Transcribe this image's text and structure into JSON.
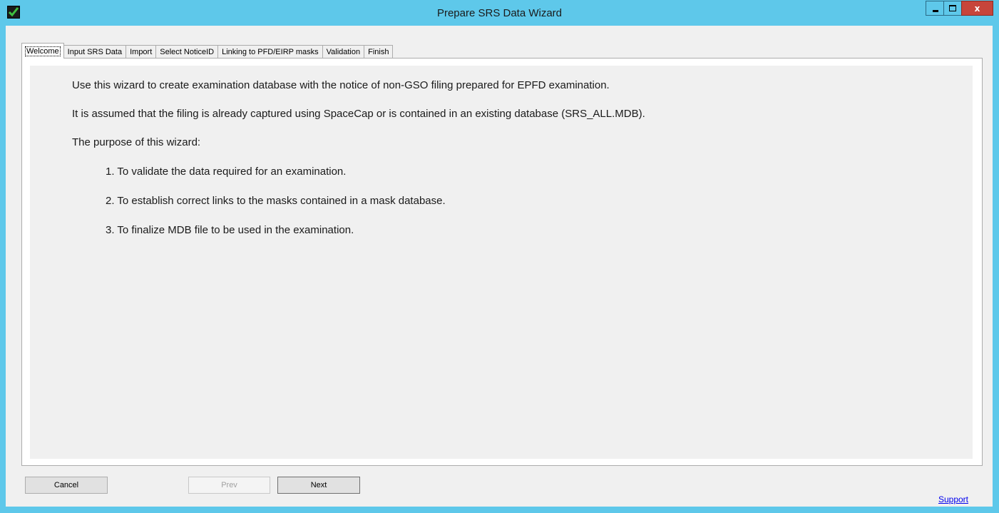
{
  "window": {
    "title": "Prepare SRS Data Wizard",
    "icon": "green-checkmark-icon",
    "controls": {
      "minimize": "minimize-icon",
      "maximize": "maximize-icon",
      "close_label": "x"
    }
  },
  "tabs": [
    {
      "label": "Welcome",
      "active": true
    },
    {
      "label": "Input SRS Data",
      "active": false
    },
    {
      "label": "Import",
      "active": false
    },
    {
      "label": "Select NoticeID",
      "active": false
    },
    {
      "label": "Linking to PFD/EIRP masks",
      "active": false
    },
    {
      "label": "Validation",
      "active": false
    },
    {
      "label": "Finish",
      "active": false
    }
  ],
  "welcome": {
    "line1": "Use this wizard to create examination database  with the notice of non-GSO filing prepared for EPFD examination.",
    "line2": "It is assumed that the filing is already captured using SpaceCap or is contained in an existing database (SRS_ALL.MDB).",
    "line3": "The purpose of this wizard:",
    "steps": [
      "1. To validate the data required for an examination.",
      "2. To establish correct links to the masks contained in a mask database.",
      "3. To finalize MDB file to be used in the examination."
    ]
  },
  "buttons": {
    "cancel": "Cancel",
    "prev": "Prev",
    "next": "Next"
  },
  "links": {
    "support": "Support"
  },
  "colors": {
    "title_bar": "#5ec8ea",
    "close_button": "#c7453b",
    "link": "#0000ee"
  }
}
